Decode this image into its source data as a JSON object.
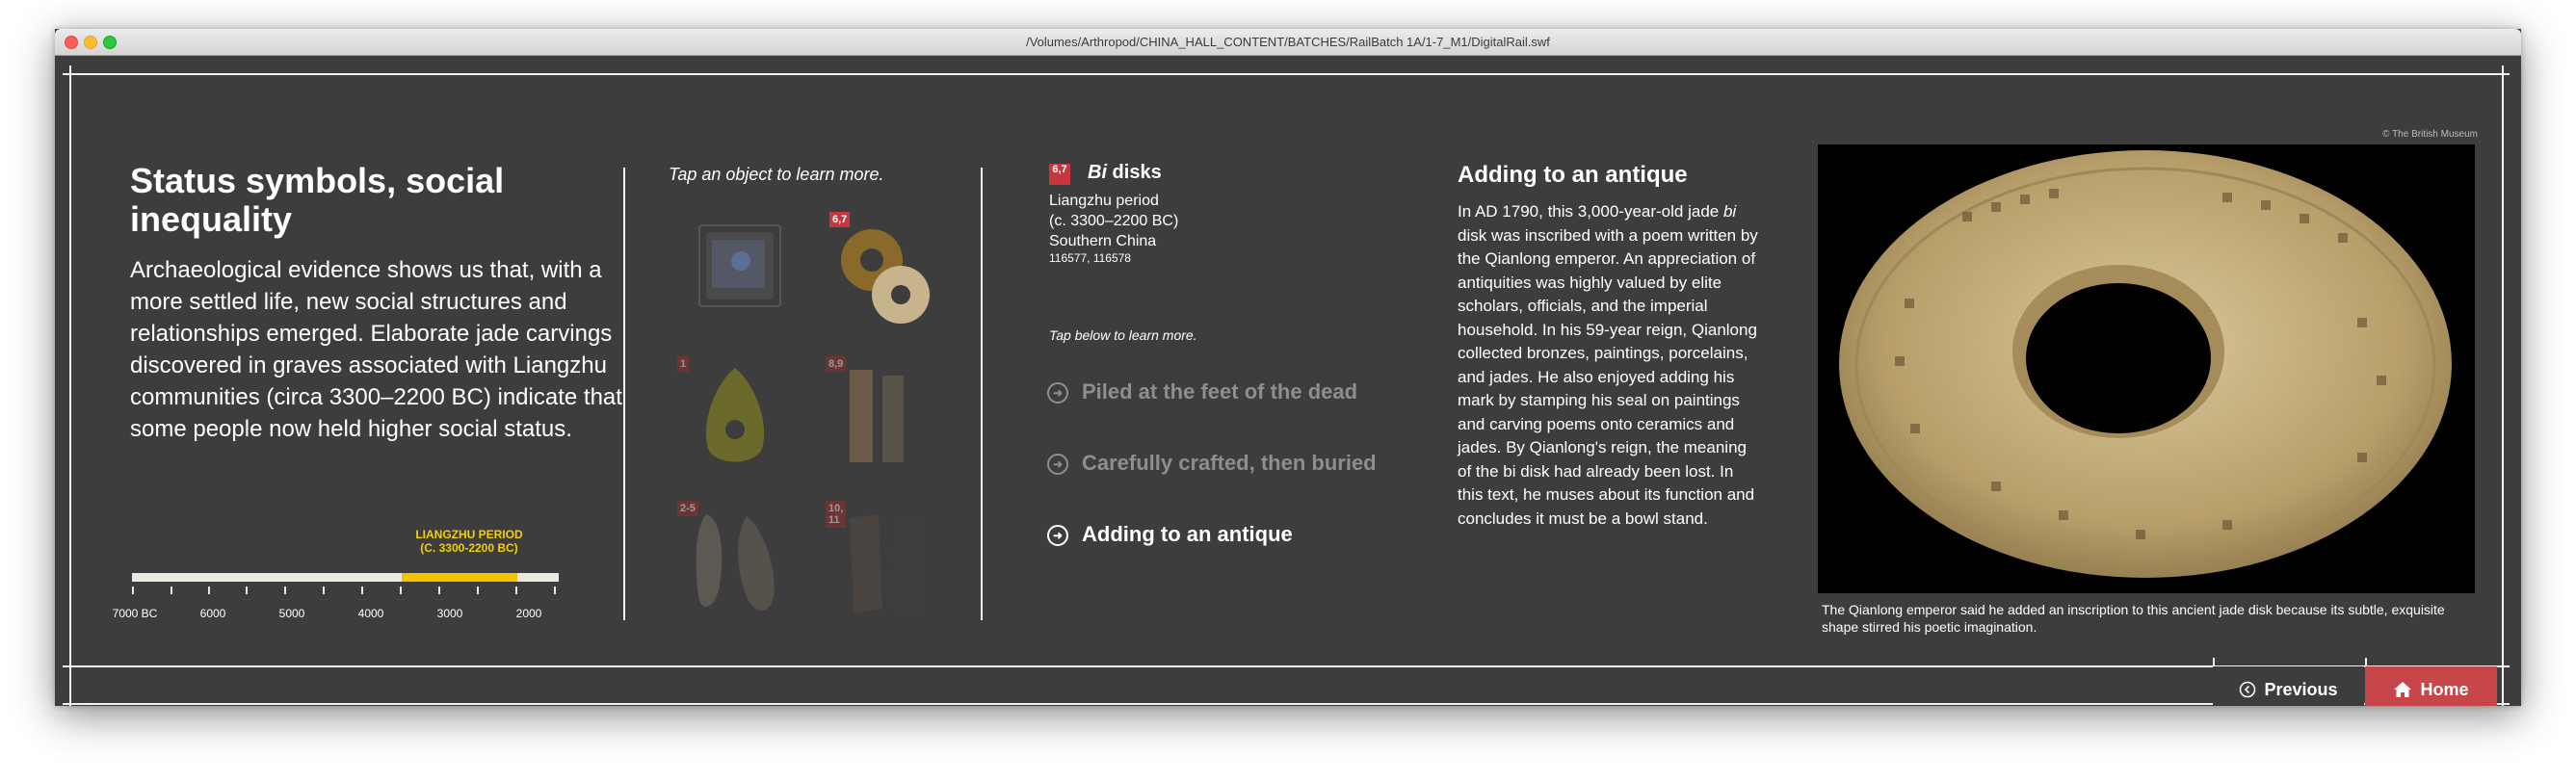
{
  "window": {
    "title": "/Volumes/Arthropod/CHINA_HALL_CONTENT/BATCHES/RailBatch 1A/1-7_M1/DigitalRail.swf"
  },
  "intro": {
    "title": "Status symbols, social inequality",
    "body": "Archaeological evidence shows us that, with a more settled life, new social structures and relationships emerged. Elaborate jade carvings discovered in graves associated with Liangzhu communities (circa 3300–2200 BC) indicate that some people now held higher social status."
  },
  "timeline": {
    "period_line1": "LIANGZHU PERIOD",
    "period_line2": "(C. 3300-2200 BC)",
    "ticks": [
      "7000 BC",
      "6000",
      "5000",
      "4000",
      "3000",
      "2000"
    ],
    "highlight_color": "#f2c400"
  },
  "objects_panel": {
    "instruction": "Tap an object to learn more.",
    "badges": [
      "6,7",
      "1",
      "8,9",
      "2-5",
      "10,\n11"
    ]
  },
  "object": {
    "badge": "6,7",
    "title_italic": "Bi",
    "title_rest": " disks",
    "period": "Liangzhu period",
    "dates": "(c. 3300–2200 BC)",
    "place": "Southern China",
    "ids": "116577, 116578",
    "instruction": "Tap below to learn more."
  },
  "stories": [
    {
      "label": "Piled at the feet of the dead",
      "active": false
    },
    {
      "label": "Carefully crafted, then buried",
      "active": false
    },
    {
      "label": "Adding to an antique",
      "active": true
    }
  ],
  "description": {
    "title": "Adding to an antique",
    "text_before_bi": "In AD 1790, this 3,000-year-old jade ",
    "bi": "bi",
    "text_after_bi": " disk was inscribed with a poem written by the Qianlong emperor. An appreciation of antiquities was highly valued by elite scholars, officials, and the imperial household. In his 59-year reign, Qianlong collected bronzes, paintings, porcelains, and jades. He also enjoyed adding his mark by stamping his seal on paintings and carving poems onto ceramics and jades. By Qianlong's reign, the meaning of the bi disk had already been lost. In this text, he muses about its function and concludes it must be a bowl stand."
  },
  "image": {
    "copyright": "© The British Museum",
    "caption": "The Qianlong emperor said he added an inscription to this ancient jade disk because its subtle, exquisite shape stirred his poetic imagination."
  },
  "nav": {
    "previous_label": "Previous",
    "home_label": "Home",
    "previous_icon": "chevron-left-circle-icon",
    "home_icon": "home-icon",
    "home_color": "#c6464a"
  }
}
